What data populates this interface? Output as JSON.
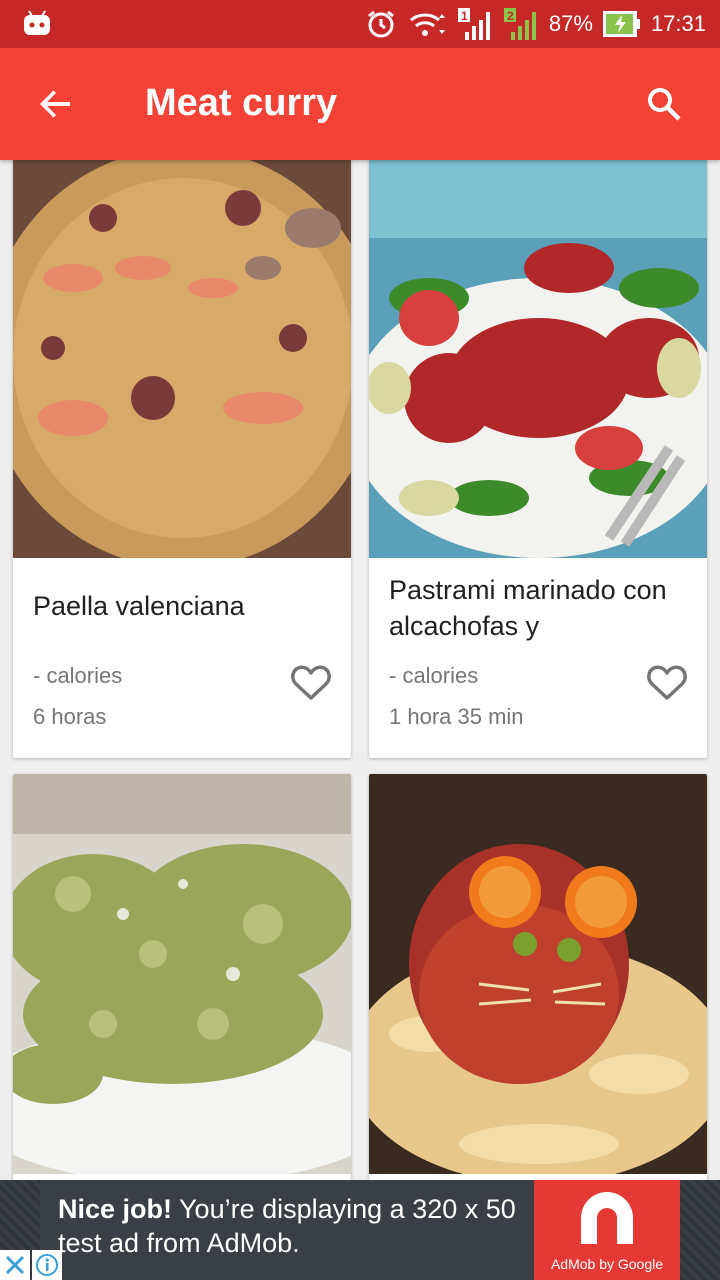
{
  "status_bar": {
    "battery": "87%",
    "time": "17:31",
    "sim1": "1",
    "sim2": "2",
    "icons": [
      "android-notification-icon",
      "alarm-icon",
      "wifi-icon",
      "signal-icon",
      "battery-charging-icon"
    ]
  },
  "app_bar": {
    "title": "Meat curry",
    "back_icon": "arrow-back-icon",
    "search_icon": "search-icon",
    "color": "#f44336"
  },
  "recipes": [
    {
      "title": "Paella valenciana",
      "calories": "- calories",
      "time": "6 horas",
      "image": "paella-photo"
    },
    {
      "title": "Pastrami marinado con alcachofas y",
      "calories": "- calories",
      "time": "1 hora 35 min",
      "image": "pastrami-salad-photo"
    },
    {
      "title": "",
      "image": "green-scrambled-dish-photo"
    },
    {
      "title": "",
      "image": "meatloaf-mouse-on-rice-photo"
    }
  ],
  "ad": {
    "headline": "Nice job!",
    "body": "You’re displaying a 320 x 50 test ad from AdMob.",
    "brand": "AdMob by Google",
    "close_icon": "close-icon",
    "info_icon": "info-icon"
  }
}
